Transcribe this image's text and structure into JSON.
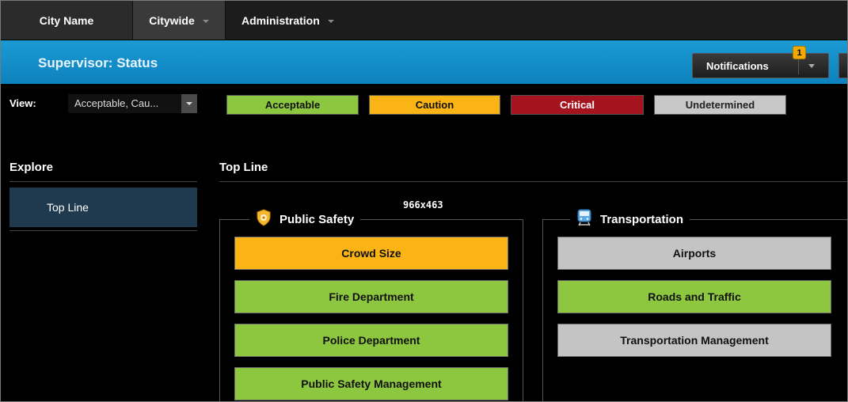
{
  "topnav": {
    "city": "City Name",
    "citywide": "Citywide",
    "administration": "Administration"
  },
  "header": {
    "title": "Supervisor: Status",
    "notifications_label": "Notifications",
    "notifications_count": "1"
  },
  "view": {
    "label": "View:",
    "selected": "Acceptable, Cau..."
  },
  "legend": {
    "acceptable": "Acceptable",
    "caution": "Caution",
    "critical": "Critical",
    "undetermined": "Undetermined"
  },
  "sidebar": {
    "heading": "Explore",
    "items": [
      {
        "label": "Top Line"
      }
    ]
  },
  "main": {
    "heading": "Top Line",
    "dimensions_label": "966x463",
    "groups": [
      {
        "title": "Public Safety",
        "icon": "shield-badge-icon",
        "tiles": [
          {
            "label": "Crowd Size",
            "status": "caution"
          },
          {
            "label": "Fire Department",
            "status": "acceptable"
          },
          {
            "label": "Police Department",
            "status": "acceptable"
          },
          {
            "label": "Public Safety Management",
            "status": "acceptable"
          }
        ]
      },
      {
        "title": "Transportation",
        "icon": "train-icon",
        "tiles": [
          {
            "label": "Airports",
            "status": "undetermined"
          },
          {
            "label": "Roads and Traffic",
            "status": "acceptable"
          },
          {
            "label": "Transportation Management",
            "status": "undetermined"
          }
        ]
      }
    ]
  },
  "colors": {
    "acceptable": "#8dc63f",
    "caution": "#fbb416",
    "critical": "#a5141e",
    "undetermined": "#c8c8c8",
    "header_blue": "#1690cc"
  }
}
